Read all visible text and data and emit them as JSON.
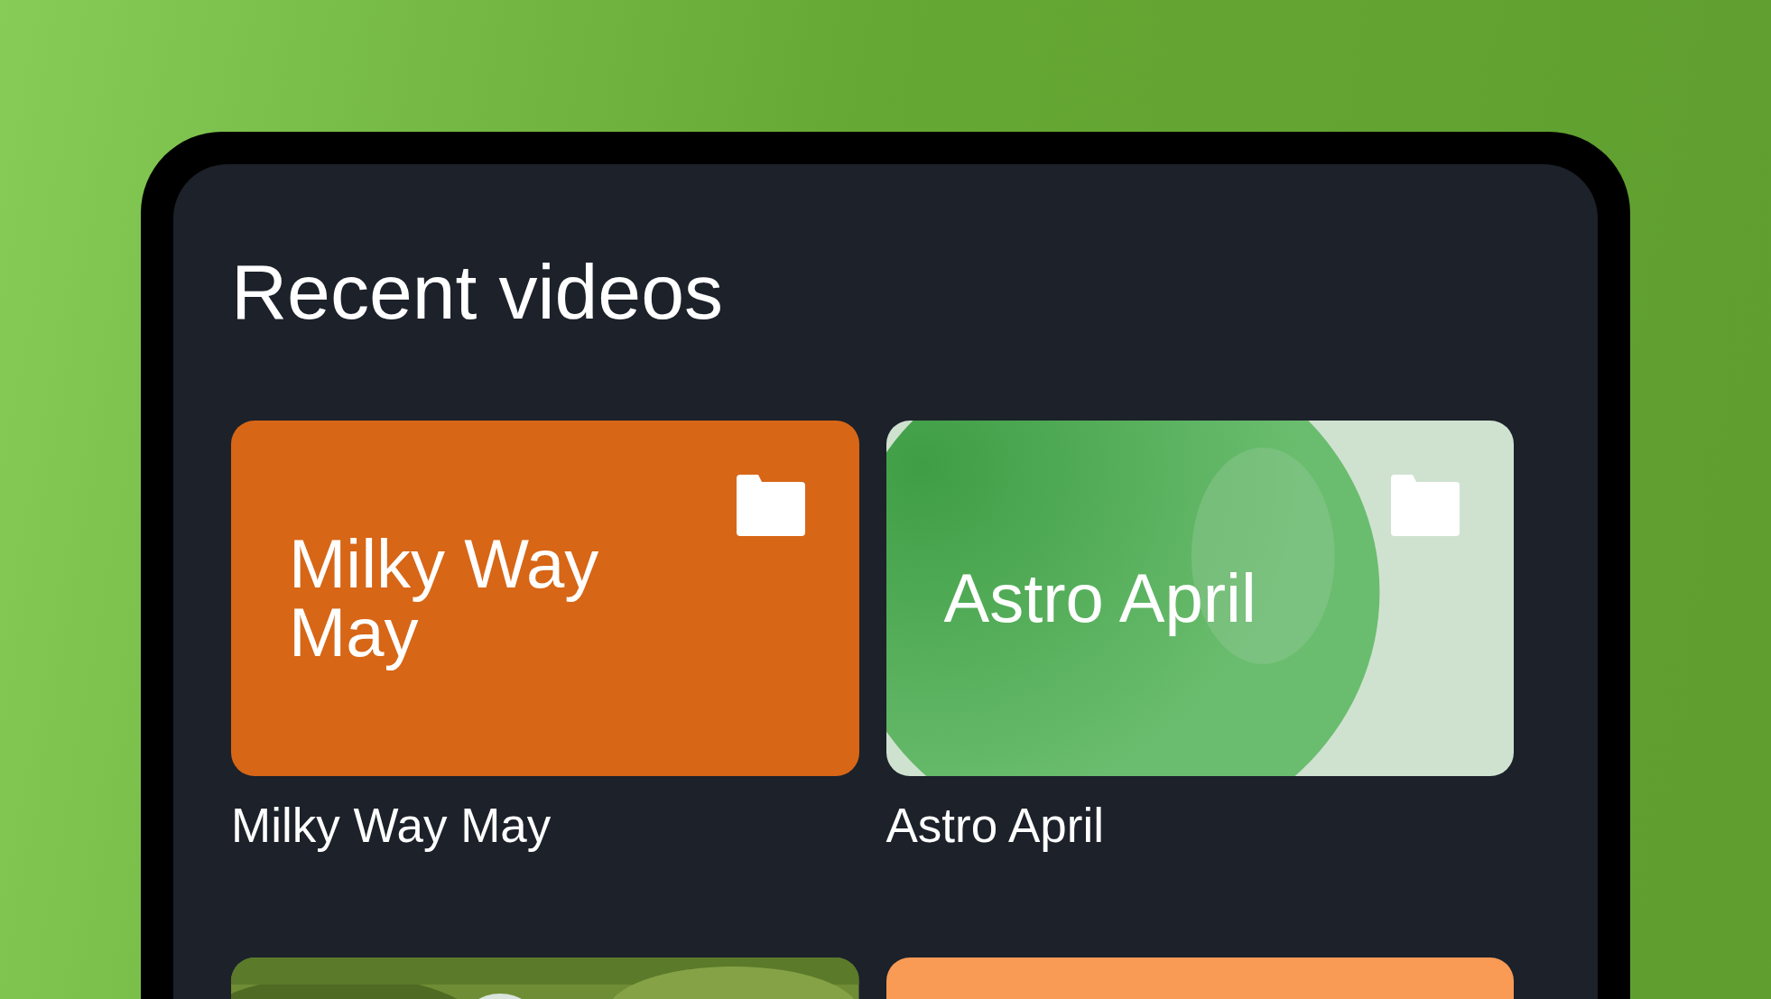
{
  "title": "Recent videos",
  "videos": [
    {
      "kind": "solid",
      "color": "#d76616",
      "card_title": "Milky Way May",
      "caption": "Milky Way May",
      "folder": true
    },
    {
      "kind": "picture",
      "card_title": "Astro April",
      "caption": "Astro April",
      "folder": true
    },
    {
      "kind": "picture"
    },
    {
      "kind": "solid",
      "color": "#f99a55"
    }
  ]
}
